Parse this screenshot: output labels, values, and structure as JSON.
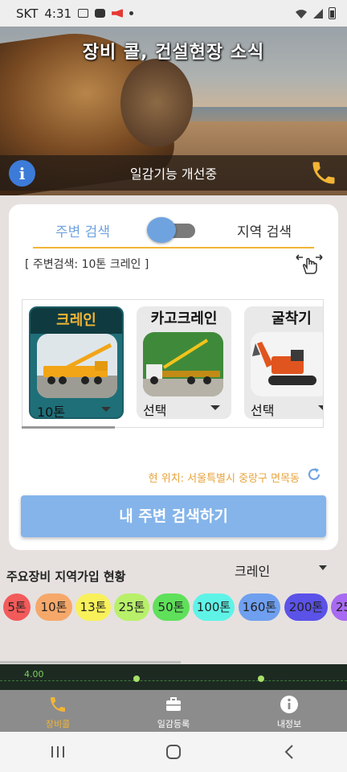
{
  "status": {
    "carrier": "SKT",
    "time": "4:31"
  },
  "hero": {
    "title": "장비 콜, 건설현장 소식",
    "notice": "일감기능 개선중"
  },
  "search": {
    "tab_near": "주변 검색",
    "tab_region": "지역 검색",
    "summary": "[ 주변검색:  10톤 크레인 ]",
    "location": "현 위치: 서울특별시 중랑구 면목동",
    "button": "내 주변 검색하기"
  },
  "equipment": [
    {
      "label": "크레인",
      "value": "10톤",
      "selected": true
    },
    {
      "label": "카고크레인",
      "value": "선택",
      "selected": false
    },
    {
      "label": "굴착기",
      "value": "선택",
      "selected": false
    }
  ],
  "stats": {
    "title": "주요장비 지역가입 현황",
    "select": "크레인",
    "chips": [
      {
        "label": "5톤",
        "color": "#f35a5a"
      },
      {
        "label": "10톤",
        "color": "#f6a86a"
      },
      {
        "label": "13톤",
        "color": "#f8f15a"
      },
      {
        "label": "25톤",
        "color": "#b8f06a"
      },
      {
        "label": "50톤",
        "color": "#5fe05a"
      },
      {
        "label": "100톤",
        "color": "#5ff3e8"
      },
      {
        "label": "160톤",
        "color": "#6f9fef"
      },
      {
        "label": "200톤",
        "color": "#5b52e8"
      },
      {
        "label": "25",
        "color": "#a86af0"
      }
    ]
  },
  "strip": {
    "value": "4.00"
  },
  "nav": [
    {
      "label": "장비콜",
      "icon": "phone-icon",
      "active": true
    },
    {
      "label": "일감등록",
      "icon": "briefcase-icon",
      "active": false
    },
    {
      "label": "내정보",
      "icon": "info-icon",
      "active": false
    }
  ],
  "colors": {
    "accent": "#f2b535",
    "primary": "#84b4ea",
    "teal": "#1f6f78"
  }
}
